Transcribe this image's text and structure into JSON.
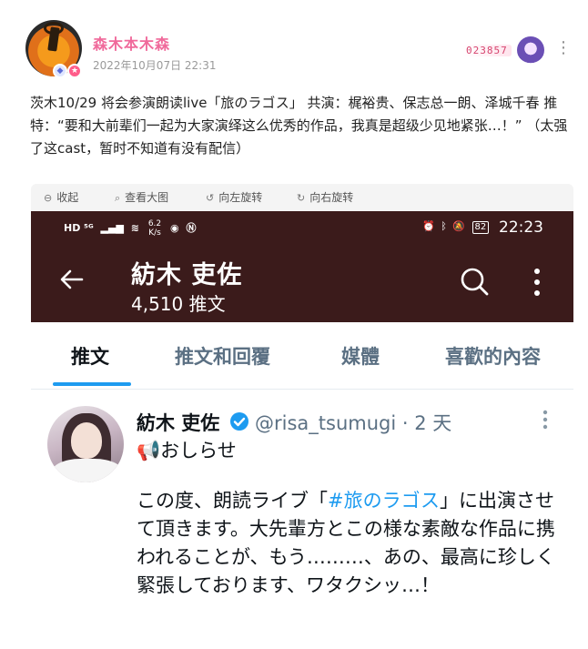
{
  "post": {
    "username": "森木本木森",
    "timestamp": "2022年10月07日 22:31",
    "fan_badge_number": "023857",
    "text": "茨木10/29 将会参演朗读live「旅のラゴス」 共演：梶裕贵、保志总一朗、泽城千春 推特：“要和大前辈们一起为大家演绎这么优秀的作品，我真是超级少见地紧张…！” （太强了这cast，暂时不知道有没有配信）"
  },
  "image_toolbar": {
    "collapse": "收起",
    "view_large": "查看大图",
    "rotate_left": "向左旋转",
    "rotate_right": "向右旋转"
  },
  "screenshot": {
    "status_bar": {
      "left_icons": "HD ⁵ᴳ",
      "speed_value": "6.2",
      "speed_unit": "K/s",
      "battery": "82",
      "time": "22:23"
    },
    "header": {
      "name": "紡木 吏佐",
      "tweet_count": "4,510 推文"
    },
    "tabs": [
      {
        "label": "推文"
      },
      {
        "label": "推文和回覆"
      },
      {
        "label": "媒體"
      },
      {
        "label": "喜歡的內容"
      }
    ],
    "tweet": {
      "name": "紡木 吏佐",
      "handle_time": "@risa_tsumugi · 2 天",
      "announce": "📢おしらせ",
      "body_before": "この度、朗読ライブ「",
      "hashtag": "#旅のラゴス",
      "body_after": "」に出演させて頂きます。大先輩方とこの様な素敵な作品に携われることが、もう………、あの、最高に珍しく緊張しております、ワタクシッ…！"
    }
  },
  "colors": {
    "username": "#f06a9b",
    "twitter_header_bg": "#3b1b1b",
    "twitter_blue": "#1d9bf0"
  }
}
